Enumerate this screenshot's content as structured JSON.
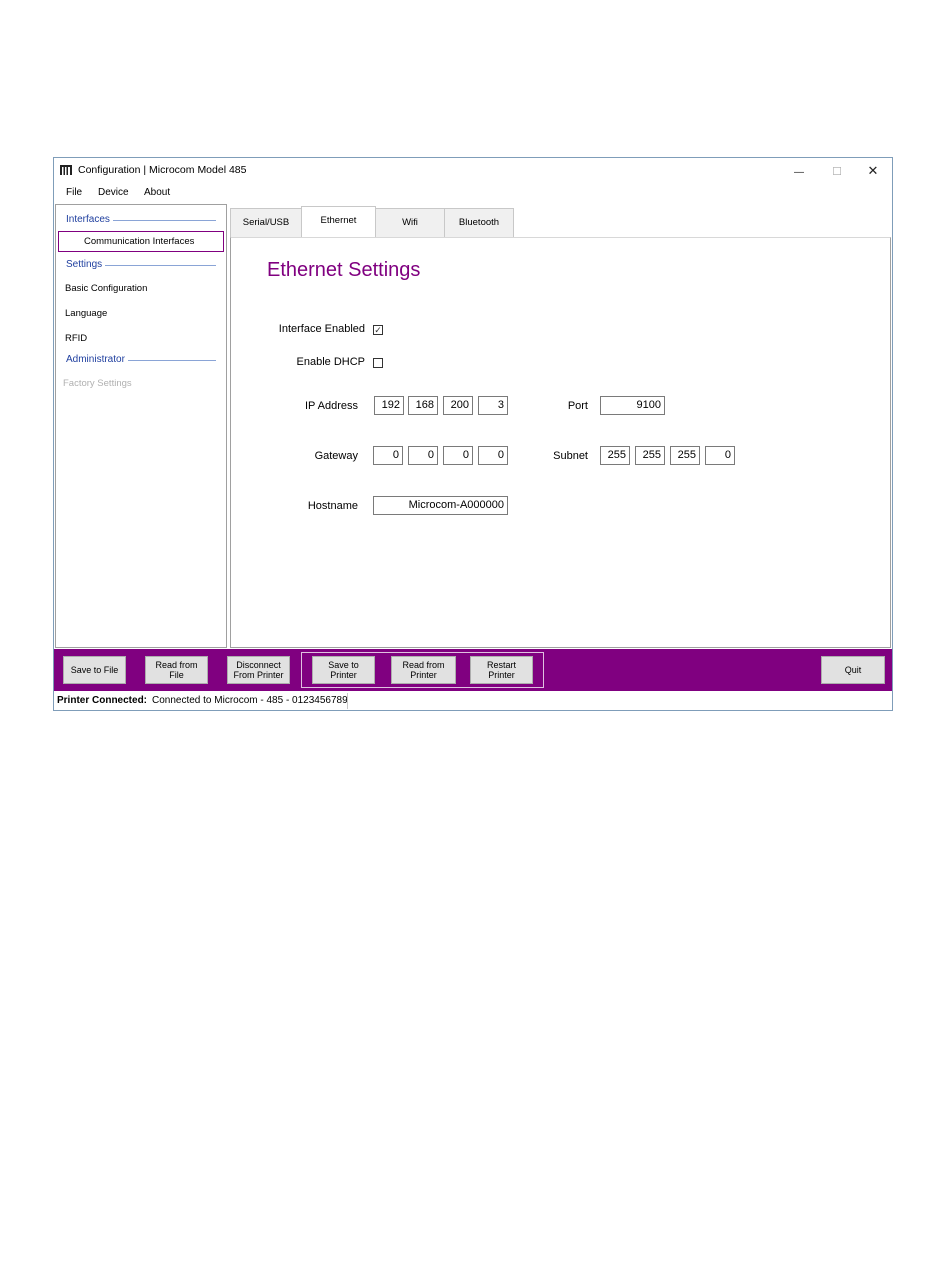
{
  "window": {
    "title": "Configuration | Microcom Model 485",
    "minimize_glyph": "—",
    "maximize_glyph": "☐",
    "close_glyph": "✕"
  },
  "menu": {
    "items": [
      "File",
      "Device",
      "About"
    ]
  },
  "sidebar": {
    "groups": {
      "interfaces": "Interfaces",
      "settings": "Settings",
      "administrator": "Administrator"
    },
    "items": {
      "communication_interfaces": "Communication Interfaces",
      "basic_configuration": "Basic Configuration",
      "language": "Language",
      "rfid": "RFID",
      "factory_settings": "Factory Settings"
    }
  },
  "tabs": [
    "Serial/USB",
    "Ethernet",
    "Wifi",
    "Bluetooth"
  ],
  "panel": {
    "title": "Ethernet Settings",
    "interface_enabled_label": "Interface Enabled",
    "interface_enabled_mark": "✓",
    "enable_dhcp_label": "Enable DHCP",
    "ip_address_label": "IP Address",
    "ip_address": [
      "192",
      "168",
      "200",
      "3"
    ],
    "port_label": "Port",
    "port": "9100",
    "gateway_label": "Gateway",
    "gateway": [
      "0",
      "0",
      "0",
      "0"
    ],
    "subnet_label": "Subnet",
    "subnet": [
      "255",
      "255",
      "255",
      "0"
    ],
    "hostname_label": "Hostname",
    "hostname": "Microcom-A000000"
  },
  "footer": {
    "save_to_file": "Save to File",
    "read_from_file": [
      "Read from",
      "File"
    ],
    "disconnect": [
      "Disconnect",
      "From Printer"
    ],
    "save_to_printer": [
      "Save to",
      "Printer"
    ],
    "read_from_printer": [
      "Read from",
      "Printer"
    ],
    "restart_printer": [
      "Restart",
      "Printer"
    ],
    "quit": "Quit"
  },
  "status": {
    "label": "Printer Connected:",
    "text": "Connected to Microcom - 485 - 0123456789"
  },
  "colors": {
    "accent": "#800080",
    "group_header": "#1f3f9f"
  }
}
